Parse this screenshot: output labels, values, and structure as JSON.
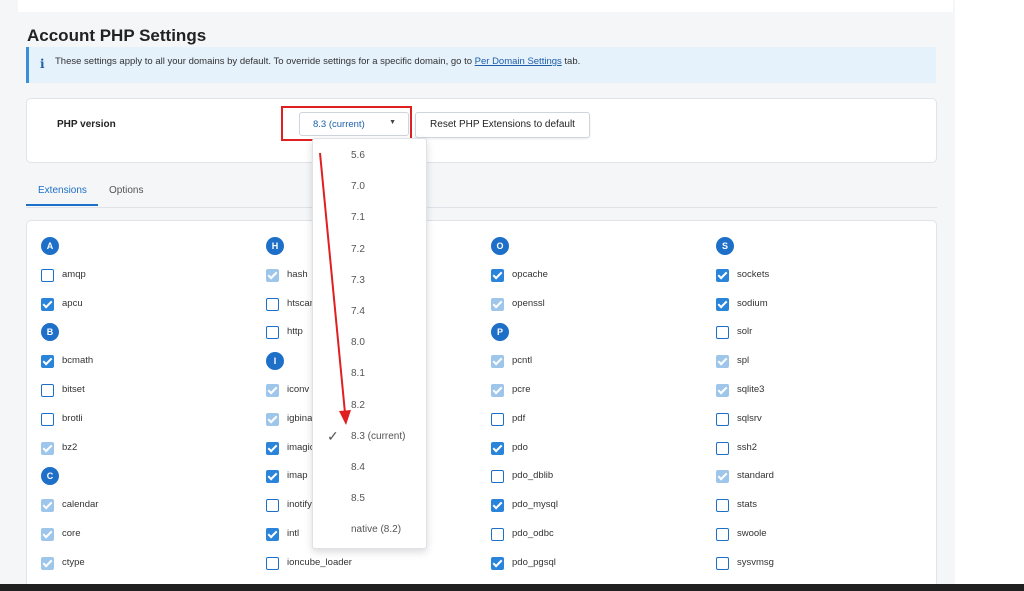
{
  "page_title": "Account PHP Settings",
  "notice": {
    "text_before": "These settings apply to all your domains by default. To override settings for a specific domain, go to ",
    "link": "Per Domain Settings",
    "text_after": " tab."
  },
  "php_version": {
    "label": "PHP version",
    "selected": "8.3 (current)",
    "reset_button": "Reset PHP Extensions to default"
  },
  "tabs": [
    {
      "label": "Extensions",
      "active": true
    },
    {
      "label": "Options",
      "active": false
    }
  ],
  "dropdown_options": [
    {
      "label": "5.6",
      "selected": false
    },
    {
      "label": "7.0",
      "selected": false
    },
    {
      "label": "7.1",
      "selected": false
    },
    {
      "label": "7.2",
      "selected": false
    },
    {
      "label": "7.3",
      "selected": false
    },
    {
      "label": "7.4",
      "selected": false
    },
    {
      "label": "8.0",
      "selected": false
    },
    {
      "label": "8.1",
      "selected": false
    },
    {
      "label": "8.2",
      "selected": false
    },
    {
      "label": "8.3 (current)",
      "selected": true
    },
    {
      "label": "8.4",
      "selected": false
    },
    {
      "label": "8.5",
      "selected": false
    },
    {
      "label": "native (8.2)",
      "selected": false
    }
  ],
  "extensions": {
    "col1": [
      {
        "type": "letter",
        "text": "A"
      },
      {
        "type": "ext",
        "name": "amqp",
        "state": "unchecked"
      },
      {
        "type": "ext",
        "name": "apcu",
        "state": "checked"
      },
      {
        "type": "letter",
        "text": "B"
      },
      {
        "type": "ext",
        "name": "bcmath",
        "state": "checked"
      },
      {
        "type": "ext",
        "name": "bitset",
        "state": "unchecked"
      },
      {
        "type": "ext",
        "name": "brotli",
        "state": "unchecked"
      },
      {
        "type": "ext",
        "name": "bz2",
        "state": "disabled"
      },
      {
        "type": "letter",
        "text": "C"
      },
      {
        "type": "ext",
        "name": "calendar",
        "state": "disabled"
      },
      {
        "type": "ext",
        "name": "core",
        "state": "disabled"
      },
      {
        "type": "ext",
        "name": "ctype",
        "state": "disabled"
      }
    ],
    "col2": [
      {
        "type": "letter",
        "text": "H"
      },
      {
        "type": "ext",
        "name": "hash",
        "state": "disabled"
      },
      {
        "type": "ext",
        "name": "htscan",
        "state": "unchecked"
      },
      {
        "type": "ext",
        "name": "http",
        "state": "unchecked"
      },
      {
        "type": "letter",
        "text": "I"
      },
      {
        "type": "ext",
        "name": "iconv",
        "state": "disabled"
      },
      {
        "type": "ext",
        "name": "igbinary",
        "state": "disabled"
      },
      {
        "type": "ext",
        "name": "imagick",
        "state": "checked"
      },
      {
        "type": "ext",
        "name": "imap",
        "state": "checked"
      },
      {
        "type": "ext",
        "name": "inotify",
        "state": "unchecked"
      },
      {
        "type": "ext",
        "name": "intl",
        "state": "checked"
      },
      {
        "type": "ext",
        "name": "ioncube_loader",
        "state": "unchecked"
      }
    ],
    "col3": [
      {
        "type": "letter",
        "text": "O"
      },
      {
        "type": "ext",
        "name": "opcache",
        "state": "checked"
      },
      {
        "type": "ext",
        "name": "openssl",
        "state": "disabled"
      },
      {
        "type": "letter",
        "text": "P"
      },
      {
        "type": "ext",
        "name": "pcntl",
        "state": "disabled"
      },
      {
        "type": "ext",
        "name": "pcre",
        "state": "disabled"
      },
      {
        "type": "ext",
        "name": "pdf",
        "state": "unchecked"
      },
      {
        "type": "ext",
        "name": "pdo",
        "state": "checked"
      },
      {
        "type": "ext",
        "name": "pdo_dblib",
        "state": "unchecked"
      },
      {
        "type": "ext",
        "name": "pdo_mysql",
        "state": "checked"
      },
      {
        "type": "ext",
        "name": "pdo_odbc",
        "state": "unchecked"
      },
      {
        "type": "ext",
        "name": "pdo_pgsql",
        "state": "checked"
      }
    ],
    "col4": [
      {
        "type": "letter",
        "text": "S"
      },
      {
        "type": "ext",
        "name": "sockets",
        "state": "checked"
      },
      {
        "type": "ext",
        "name": "sodium",
        "state": "checked"
      },
      {
        "type": "ext",
        "name": "solr",
        "state": "unchecked"
      },
      {
        "type": "ext",
        "name": "spl",
        "state": "disabled"
      },
      {
        "type": "ext",
        "name": "sqlite3",
        "state": "disabled"
      },
      {
        "type": "ext",
        "name": "sqlsrv",
        "state": "unchecked"
      },
      {
        "type": "ext",
        "name": "ssh2",
        "state": "unchecked"
      },
      {
        "type": "ext",
        "name": "standard",
        "state": "disabled"
      },
      {
        "type": "ext",
        "name": "stats",
        "state": "unchecked"
      },
      {
        "type": "ext",
        "name": "swoole",
        "state": "unchecked"
      },
      {
        "type": "ext",
        "name": "sysvmsg",
        "state": "unchecked"
      }
    ]
  },
  "colors": {
    "accent": "#1d6fc7",
    "annotation": "#e02020",
    "notice_bg": "#e5f1fb"
  }
}
